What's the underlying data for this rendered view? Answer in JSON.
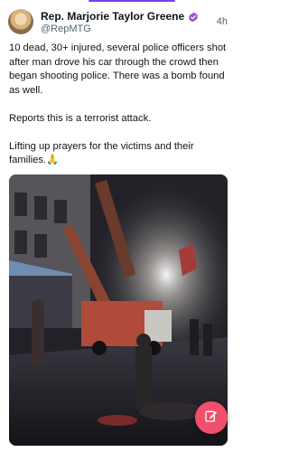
{
  "post": {
    "author_name": "Rep. Marjorie Taylor Greene",
    "handle": "@RepMTG",
    "timestamp": "4h",
    "paragraphs": [
      "10 dead, 30+ injured, several police officers shot after man drove his car through the crowd then began shooting police. There was a bomb found as well.",
      "Reports this is a terrorist attack.",
      "Lifting up prayers for the victims and their families.🙏"
    ]
  },
  "icons": {
    "verified": "verified-badge-icon",
    "compose": "compose-icon"
  },
  "colors": {
    "accent": "#7b3fe4",
    "fab": "#f0506e",
    "verified": "#9b4dd9"
  }
}
